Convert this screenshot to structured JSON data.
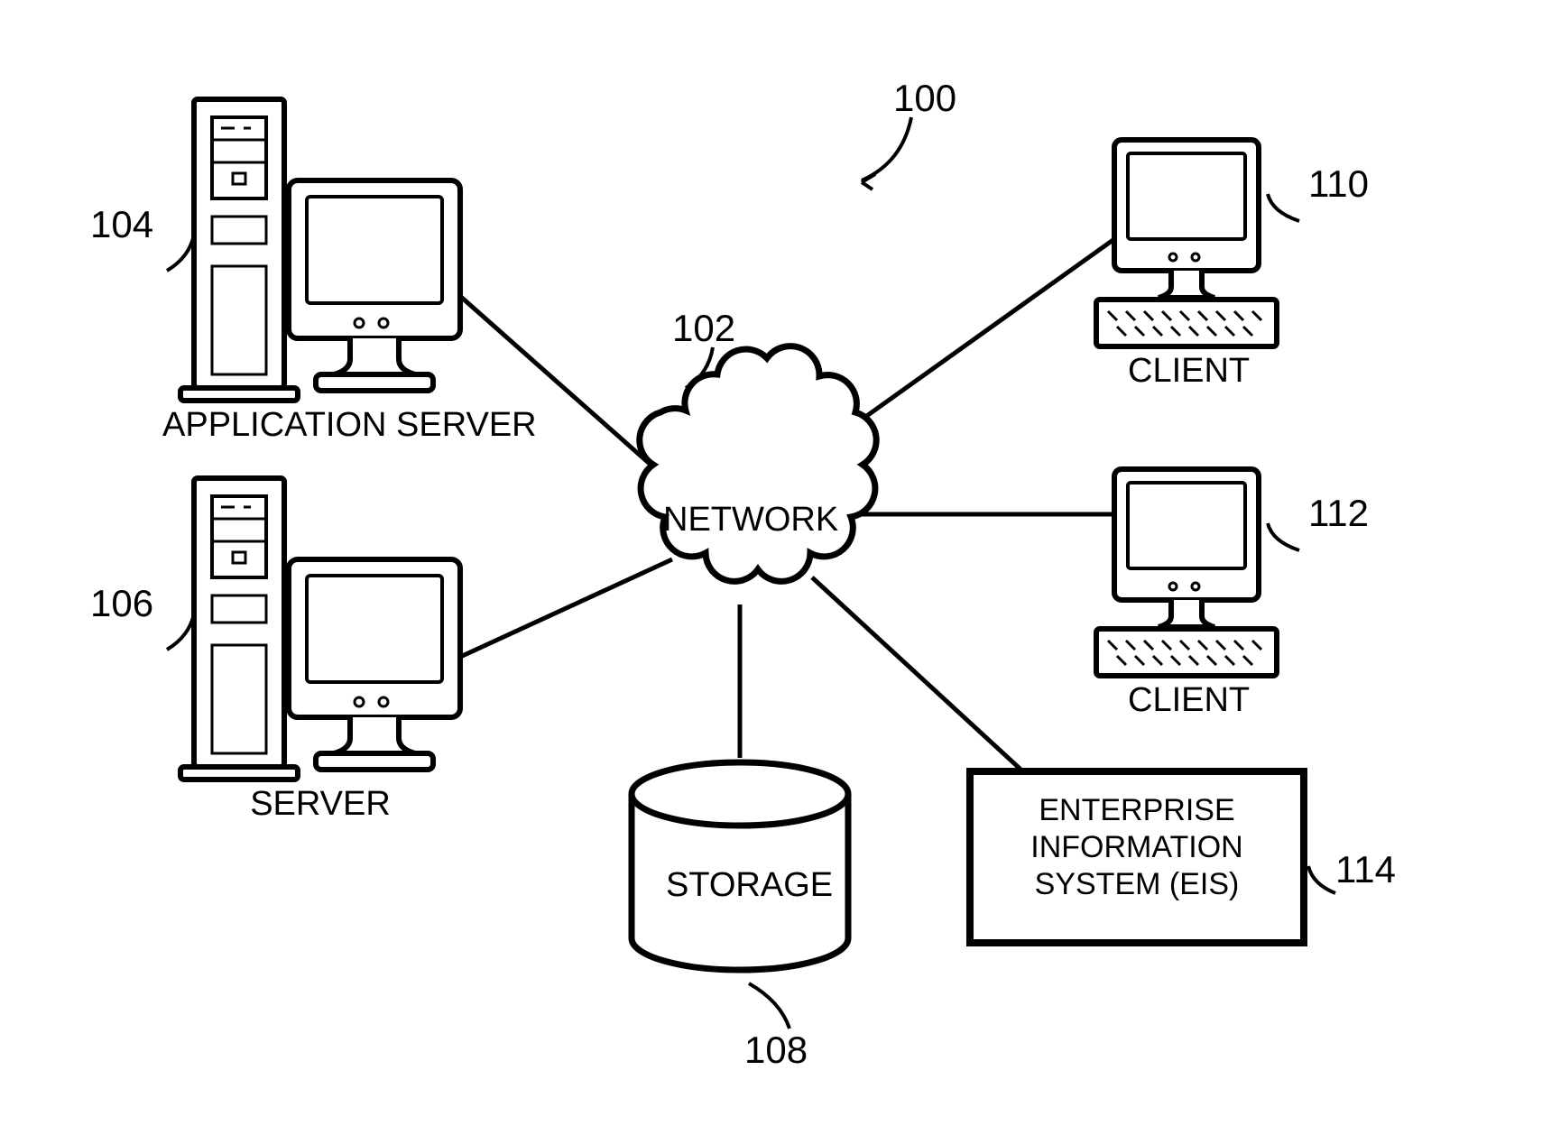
{
  "refs": {
    "system": "100",
    "network": "102",
    "appServer": "104",
    "server": "106",
    "storage": "108",
    "client1": "110",
    "client2": "112",
    "eis": "114"
  },
  "labels": {
    "appServer": "APPLICATION SERVER",
    "server": "SERVER",
    "network": "NETWORK",
    "storage": "STORAGE",
    "client1": "CLIENT",
    "client2": "CLIENT",
    "eis": "ENTERPRISE INFORMATION SYSTEM (EIS)"
  }
}
